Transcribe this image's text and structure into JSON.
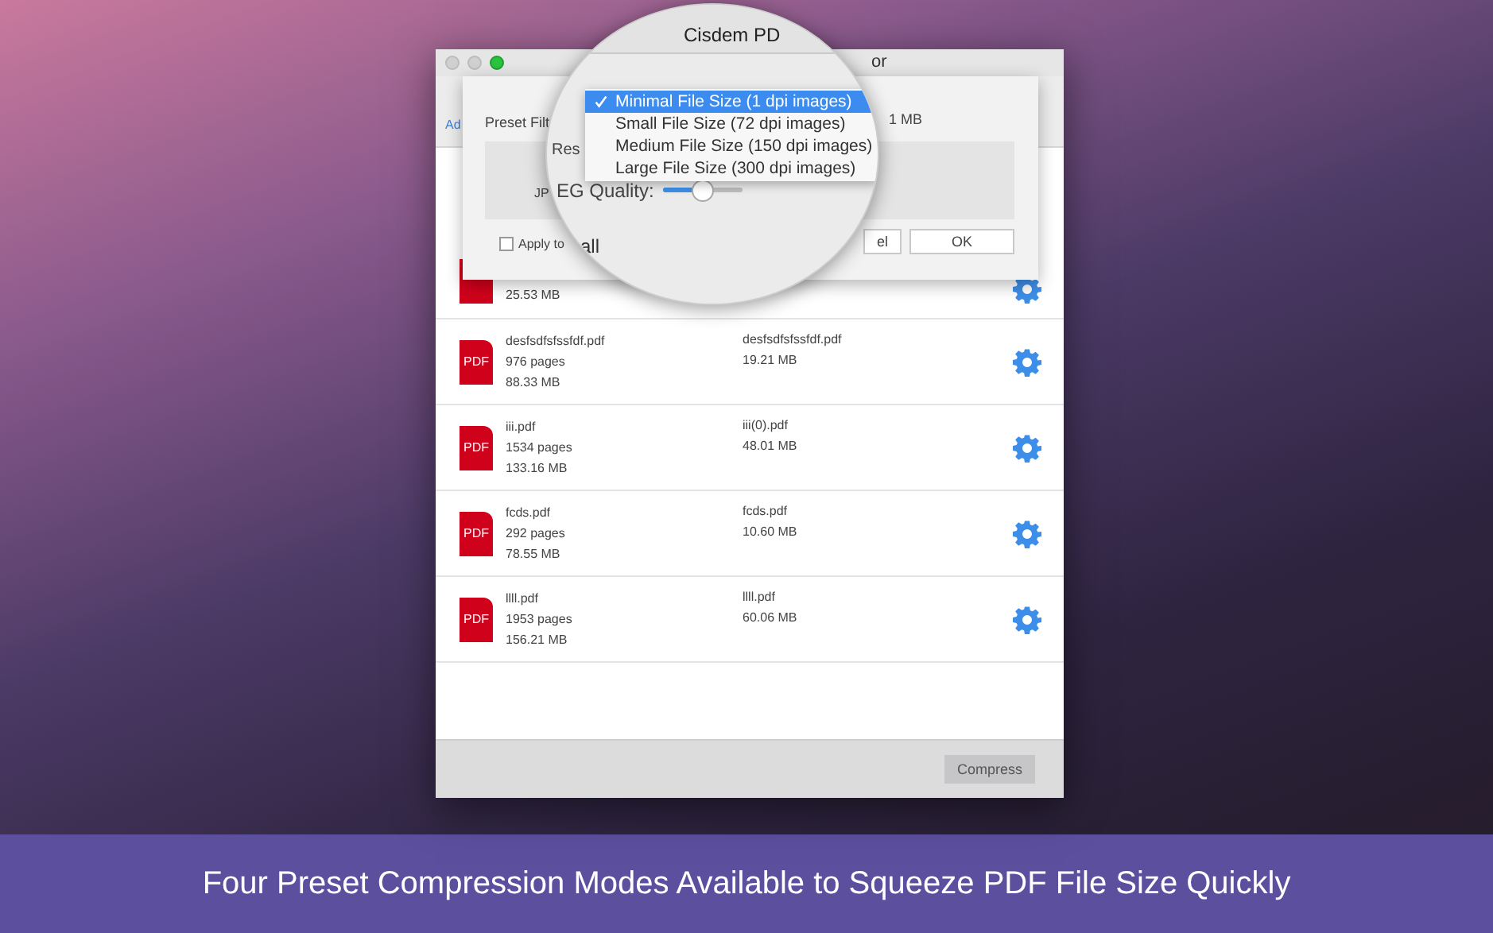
{
  "window": {
    "title_fragment": "or",
    "toolbar_label": "Ad"
  },
  "dialog": {
    "preset_label": "Preset Filt",
    "size_fragment": "1 MB",
    "jpeg_label": "JP",
    "apply": {
      "label": "Apply to",
      "checked": false
    },
    "buttons": [
      "el",
      "OK"
    ]
  },
  "magnifier": {
    "title": "Cisdem PD",
    "resolution_label": "Res",
    "quality_label": "EG Quality:",
    "apply_label": "all",
    "quality": {
      "level": 0.5
    },
    "menu": [
      {
        "label": "Minimal File Size (1 dpi images)",
        "selected": true
      },
      {
        "label": "Small File Size (72 dpi images)",
        "selected": false
      },
      {
        "label": "Medium File Size (150 dpi images)",
        "selected": false
      },
      {
        "label": "Large File Size (300 dpi images)",
        "selected": false
      }
    ]
  },
  "files": [
    {
      "kind": "partial",
      "size": "25.53 MB"
    },
    {
      "kind": "full",
      "icon": "PDF",
      "name": "desfsdfsfssfdf.pdf",
      "pages": "976 pages",
      "size": "88.33 MB",
      "output_name": "desfsdfsfssfdf.pdf",
      "output_size": "19.21 MB"
    },
    {
      "kind": "full",
      "icon": "PDF",
      "name": "iii.pdf",
      "pages": "1534 pages",
      "size": "133.16 MB",
      "output_name": "iii(0).pdf",
      "output_size": "48.01 MB"
    },
    {
      "kind": "full",
      "icon": "PDF",
      "name": "fcds.pdf",
      "pages": "292 pages",
      "size": "78.55 MB",
      "output_name": "fcds.pdf",
      "output_size": "10.60 MB"
    },
    {
      "kind": "full",
      "icon": "PDF",
      "name": "llll.pdf",
      "pages": "1953 pages",
      "size": "156.21 MB",
      "output_name": "llll.pdf",
      "output_size": "60.06 MB"
    }
  ],
  "compress_button": "Compress",
  "caption": "Four Preset Compression Modes Available to Squeeze PDF File Size Quickly"
}
